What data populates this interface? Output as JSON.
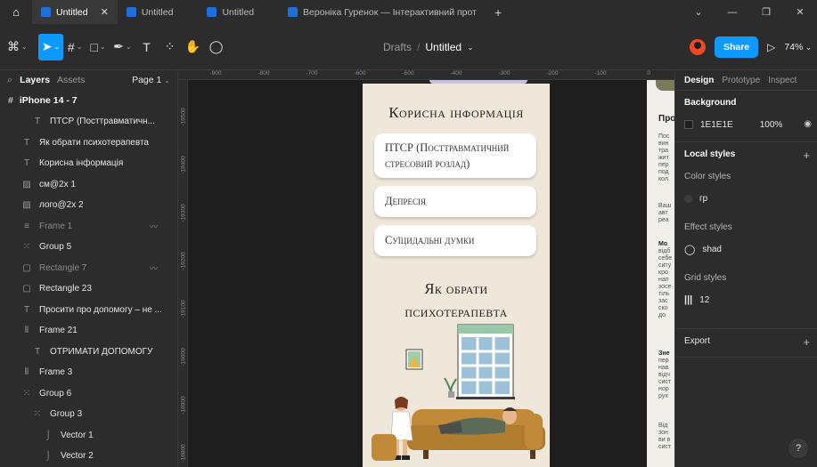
{
  "tabs": [
    {
      "label": "Untitled",
      "active": true
    },
    {
      "label": "Untitled",
      "active": false
    },
    {
      "label": "Untitled",
      "active": false
    },
    {
      "label": "Вероніка Гуренок — Інтерактивний прот",
      "active": false
    }
  ],
  "toolbar": {
    "drafts": "Drafts",
    "separator": "/",
    "file_name": "Untitled",
    "share_label": "Share",
    "zoom": "74%"
  },
  "left_panel": {
    "layers_tab": "Layers",
    "assets_tab": "Assets",
    "page": "Page 1",
    "frame": "iPhone 14 - 7",
    "layers": [
      {
        "name": "ПТСР (Посттравматичн...",
        "icon": "text-icon",
        "indent": 2,
        "dim": false
      },
      {
        "name": "Як обрати психотерапевта",
        "icon": "text-icon",
        "indent": 1,
        "dim": false
      },
      {
        "name": "Корисна інформація",
        "icon": "text-icon",
        "indent": 1,
        "dim": false
      },
      {
        "name": "см@2x 1",
        "icon": "image-icon",
        "indent": 1,
        "dim": false
      },
      {
        "name": "лого@2x 2",
        "icon": "image-icon",
        "indent": 1,
        "dim": false
      },
      {
        "name": "Frame 1",
        "icon": "frame-icon",
        "indent": 1,
        "dim": true
      },
      {
        "name": "Group 5",
        "icon": "group-icon",
        "indent": 1,
        "dim": false
      },
      {
        "name": "Rectangle 7",
        "icon": "rectangle-icon",
        "indent": 1,
        "dim": true
      },
      {
        "name": "Rectangle 23",
        "icon": "rectangle-icon",
        "indent": 1,
        "dim": false
      },
      {
        "name": "Просити про допомогу – не ...",
        "icon": "text-icon",
        "indent": 1,
        "dim": false
      },
      {
        "name": "Frame 21",
        "icon": "autolayout-icon",
        "indent": 1,
        "dim": false
      },
      {
        "name": "ОТРИМАТИ ДОПОМОГУ",
        "icon": "text-icon",
        "indent": 2,
        "dim": false
      },
      {
        "name": "Frame 3",
        "icon": "autolayout-icon",
        "indent": 1,
        "dim": false
      },
      {
        "name": "Group 6",
        "icon": "group-icon",
        "indent": 1,
        "dim": false
      },
      {
        "name": "Group 3",
        "icon": "group-icon",
        "indent": 2,
        "dim": false
      },
      {
        "name": "Vector 1",
        "icon": "vector-icon",
        "indent": 3,
        "dim": false
      },
      {
        "name": "Vector 2",
        "icon": "vector-icon",
        "indent": 3,
        "dim": false
      }
    ]
  },
  "rulers": {
    "top": [
      "-900",
      "-800",
      "-700",
      "-600",
      "-500",
      "-400",
      "-300",
      "-200",
      "-100",
      "0"
    ],
    "left": [
      "-19500",
      "-19400",
      "-19300",
      "-19200",
      "-19100",
      "-19000",
      "-18900",
      "-18800"
    ]
  },
  "phone": {
    "title": "Корисна інформація",
    "cards": [
      "ПТСР (Посттравматичний стресовий розлад)",
      "Депресія",
      "Суїцидальні думки"
    ],
    "subtitle_line1": "Як обрати",
    "subtitle_line2": "психотерапевта"
  },
  "right_frame": {
    "heading": "Про",
    "para1": "Пос\nвин\nтра\nжит\nпер\nпод\nкол",
    "para2": "Ваш\nавт\nреа",
    "bold2": "Мо",
    "para3": "відб\nсебе\nситу\nкро\nнап\nзосе\nтіль\nзас\nско\nдо",
    "bold3": "Зне",
    "para4": "пер\nнав\nвідч\nсист\nнор\nрух",
    "para5": "Від\nзон\nви в\nсист"
  },
  "right_panel": {
    "tab_design": "Design",
    "tab_prototype": "Prototype",
    "tab_inspect": "Inspect",
    "background_title": "Background",
    "background_hex": "1E1E1E",
    "background_opacity": "100%",
    "local_styles_title": "Local styles",
    "color_styles": "Color styles",
    "color_style_name": "гр",
    "effect_styles": "Effect styles",
    "effect_style_name": "shad",
    "grid_styles": "Grid styles",
    "grid_style_name": "12",
    "export_title": "Export",
    "help": "?"
  },
  "colors": {
    "accent": "#0d99ff",
    "phone_bg": "#efe7da",
    "sofa": "#c08a38"
  }
}
